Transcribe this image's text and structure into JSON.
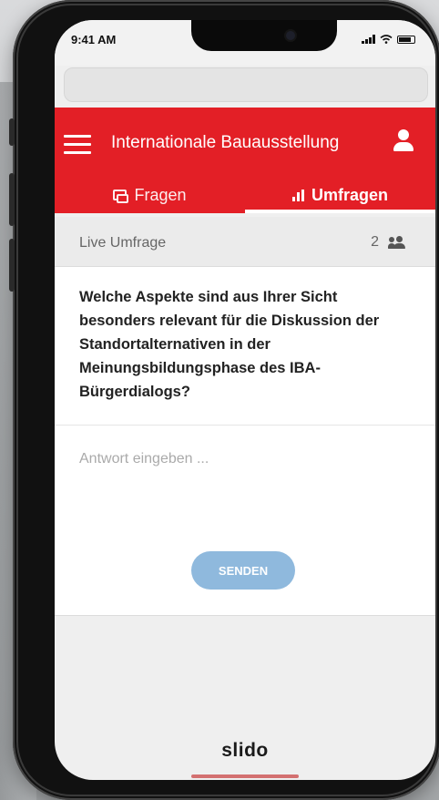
{
  "status_bar": {
    "time": "9:41 AM"
  },
  "app_bar": {
    "title": "Internationale Bauausstellung"
  },
  "tabs": [
    {
      "label": "Fragen",
      "icon": "chat-icon",
      "active": false
    },
    {
      "label": "Umfragen",
      "icon": "bar-chart-icon",
      "active": true
    }
  ],
  "poll": {
    "live_label": "Live Umfrage",
    "participants_count": "2",
    "question": "Welche Aspekte sind aus Ihrer Sicht besonders relevant für die Diskussion der Standortalternativen in der Meinungsbildungsphase des IBA-Bürgerdialogs?",
    "answer_placeholder": "Antwort eingeben ...",
    "send_label": "SENDEN"
  },
  "footer": {
    "logo": "slido"
  },
  "colors": {
    "brand_red": "#e31f26",
    "send_button": "#8fb9dd"
  }
}
